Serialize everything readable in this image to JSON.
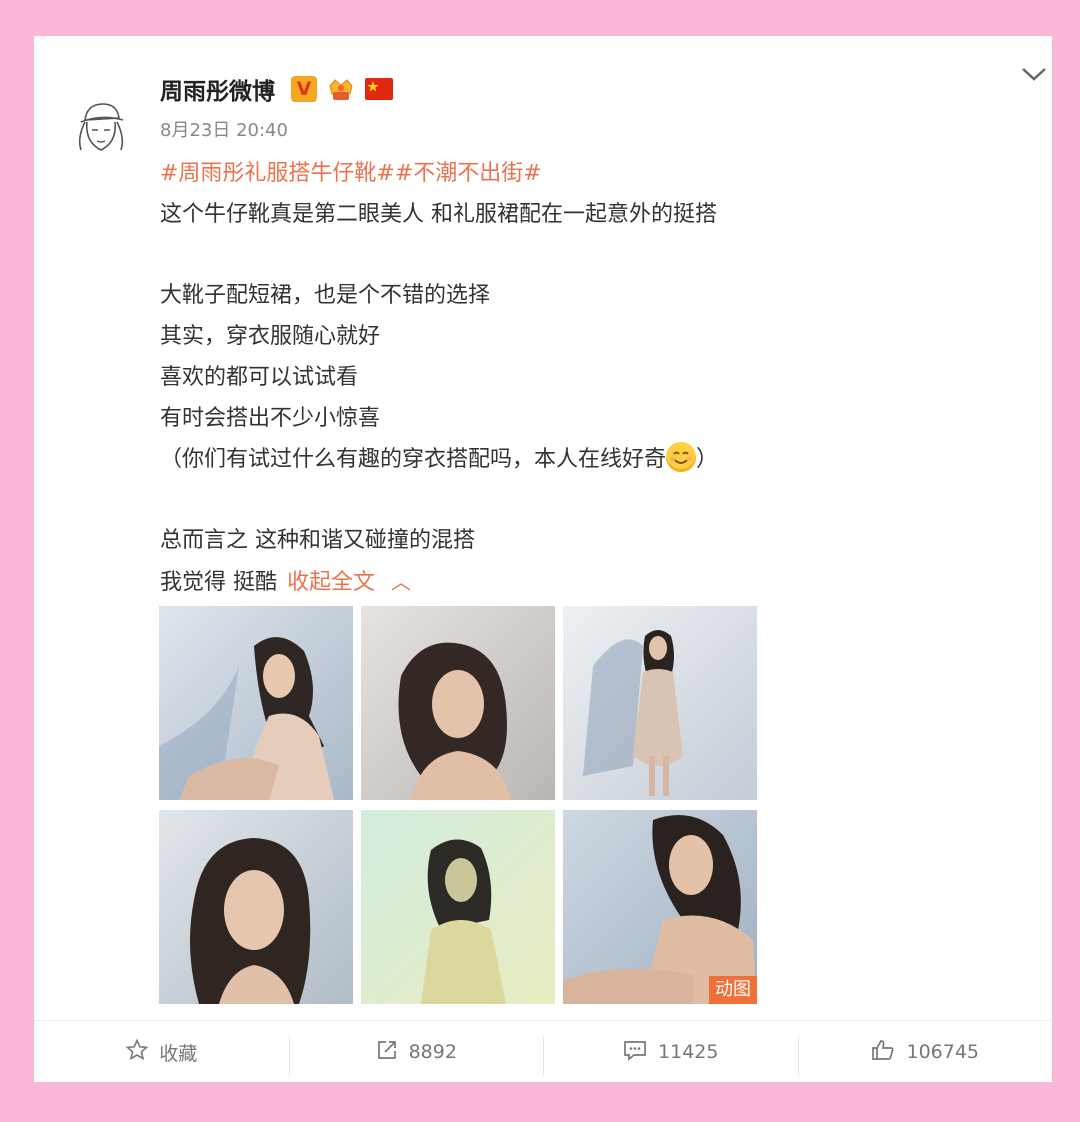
{
  "post": {
    "username": "周雨彤微博",
    "verified_badge": "V",
    "date": "8月23日 20:40",
    "hashtags": "#周雨彤礼服搭牛仔靴##不潮不出街#",
    "lines": [
      "这个牛仔靴真是第二眼美人 和礼服裙配在一起意外的挺搭",
      "",
      "大靴子配短裙，也是个不错的选择",
      "其实，穿衣服随心就好",
      "喜欢的都可以试试看",
      "有时会搭出不少小惊喜",
      "（你们有试过什么有趣的穿衣搭配吗，本人在线好奇",
      "",
      "总而言之 这种和谐又碰撞的混搭",
      "我觉得 挺酷"
    ],
    "line7_tail": "）",
    "collapse_label": "收起全文",
    "gif_label": "动图",
    "icons": [
      "chevron-down-icon",
      "v-badge-icon",
      "crown-icon",
      "china-flag-icon",
      "smile-emoji-icon",
      "star-icon",
      "share-icon",
      "comment-icon",
      "like-icon"
    ],
    "accent_color": "#eb7350"
  },
  "actions": {
    "favorite_label": "收藏",
    "repost_count": "8892",
    "comment_count": "11425",
    "like_count": "106745"
  }
}
